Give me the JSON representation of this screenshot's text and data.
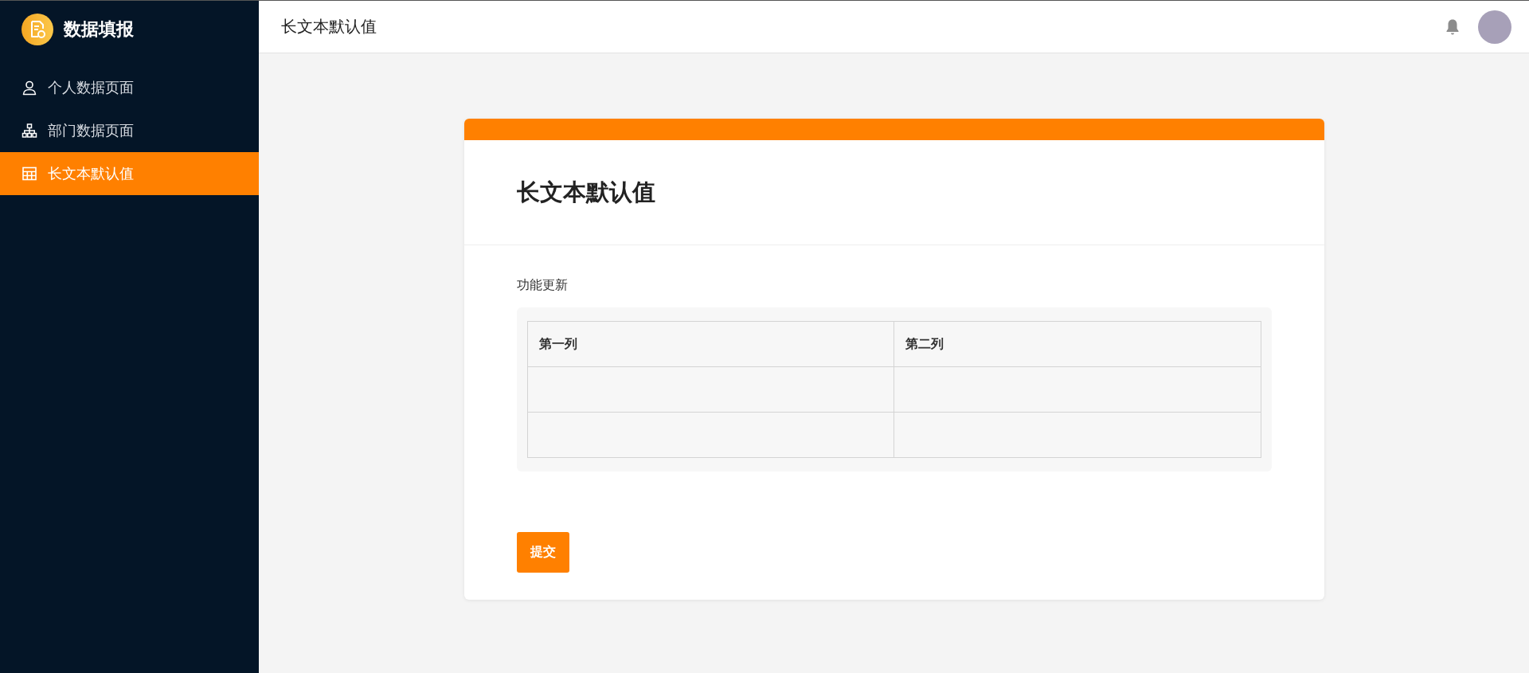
{
  "sidebar": {
    "app_name": "数据填报",
    "items": [
      {
        "label": "个人数据页面",
        "kind": "person",
        "selected": false
      },
      {
        "label": "部门数据页面",
        "kind": "hierarchy",
        "selected": false
      },
      {
        "label": "长文本默认值",
        "kind": "table",
        "selected": true
      }
    ]
  },
  "header": {
    "title": "长文本默认值"
  },
  "form": {
    "title": "长文本默认值",
    "field_label": "功能更新",
    "table": {
      "columns": [
        "第一列",
        "第二列"
      ],
      "rows": [
        {
          "cells": [
            {
              "kind": "input"
            },
            {
              "kind": "input"
            }
          ]
        },
        {
          "cells": [
            {
              "kind": "input"
            },
            {
              "kind": "input"
            }
          ]
        }
      ]
    },
    "submit": "提交"
  }
}
